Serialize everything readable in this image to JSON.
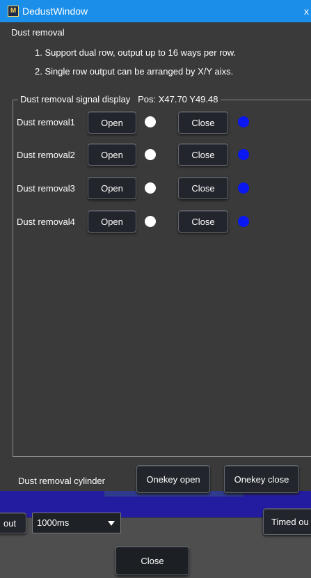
{
  "window": {
    "title": "DedustWindow",
    "close_glyph": "x"
  },
  "header": {
    "section_title": "Dust removal",
    "info_lines": [
      "1. Support dual row, output up to 16 ways per row.",
      "2. Single row output can be arranged by X/Y aixs."
    ]
  },
  "signal_group": {
    "legend": "Dust removal signal display",
    "position": "Pos: X47.70  Y49.48",
    "rows": [
      {
        "label": "Dust removal1",
        "open_label": "Open",
        "close_label": "Close",
        "open_state": "white",
        "close_state": "blue"
      },
      {
        "label": "Dust removal2",
        "open_label": "Open",
        "close_label": "Close",
        "open_state": "white",
        "close_state": "blue"
      },
      {
        "label": "Dust removal3",
        "open_label": "Open",
        "close_label": "Close",
        "open_state": "white",
        "close_state": "blue"
      },
      {
        "label": "Dust removal4",
        "open_label": "Open",
        "close_label": "Close",
        "open_state": "white",
        "close_state": "blue"
      }
    ]
  },
  "cylinder": {
    "label": "Dust removal cylinder",
    "onekey_open": "Onekey open",
    "onekey_close": "Onekey close"
  },
  "background_controls": {
    "left_partial": "out",
    "interval_value": "1000ms",
    "right_partial": "Timed ou"
  },
  "footer": {
    "close_label": "Close"
  },
  "colors": {
    "titlebar": "#1a8ee8",
    "panel": "#3a3a3a",
    "led_on": "#ffffff",
    "led_off": "#0a17f0",
    "band": "#241ca0"
  }
}
